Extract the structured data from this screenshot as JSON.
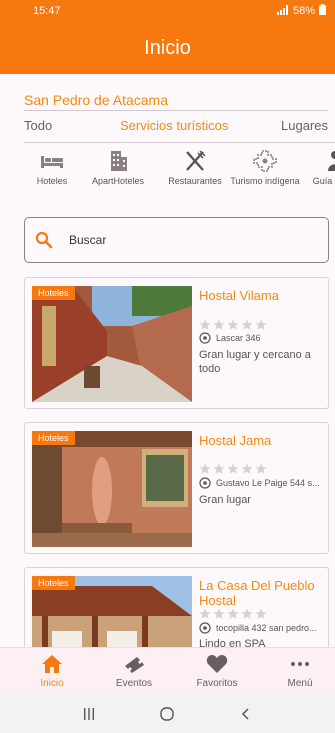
{
  "status": {
    "time": "15:47",
    "battery": "58%"
  },
  "header": {
    "title": "Inicio"
  },
  "location": "San Pedro de Atacama",
  "tabs": [
    {
      "label": "Todo",
      "active": false
    },
    {
      "label": "Servicios turísticos",
      "active": true
    },
    {
      "label": "Lugares",
      "active": false
    }
  ],
  "categories": [
    {
      "label": "Hoteles",
      "icon": "bed-icon"
    },
    {
      "label": "ApartHoteles",
      "icon": "building-icon"
    },
    {
      "label": "Restaurantes",
      "icon": "utensils-icon"
    },
    {
      "label": "Turismo indígena",
      "icon": "andean-cross-icon"
    },
    {
      "label": "Guía Turíst",
      "icon": "person-icon"
    }
  ],
  "search": {
    "placeholder": "Buscar"
  },
  "listings": [
    {
      "badge": "Hoteles",
      "title": "Hostal Vilama",
      "rating": 0,
      "address": "Lascar 346",
      "description": "Gran lugar y cercano a todo"
    },
    {
      "badge": "Hoteles",
      "title": "Hostal Jama",
      "rating": 0,
      "address": "Gustavo Le Paige 544 s...",
      "description": "Gran lugar"
    },
    {
      "badge": "Hoteles",
      "title": "La Casa Del Pueblo Hostal",
      "rating": 0,
      "address": "tocopilla 432 san pedro...",
      "description": "Lindo en SPA"
    }
  ],
  "bottom_nav": [
    {
      "label": "Inicio",
      "icon": "home-icon",
      "active": true
    },
    {
      "label": "Eventos",
      "icon": "ticket-icon",
      "active": false
    },
    {
      "label": "Favoritos",
      "icon": "heart-icon",
      "active": false
    },
    {
      "label": "Menú",
      "icon": "more-icon",
      "active": false
    }
  ],
  "colors": {
    "accent": "#f7780f",
    "accent_text": "#f28b12"
  }
}
